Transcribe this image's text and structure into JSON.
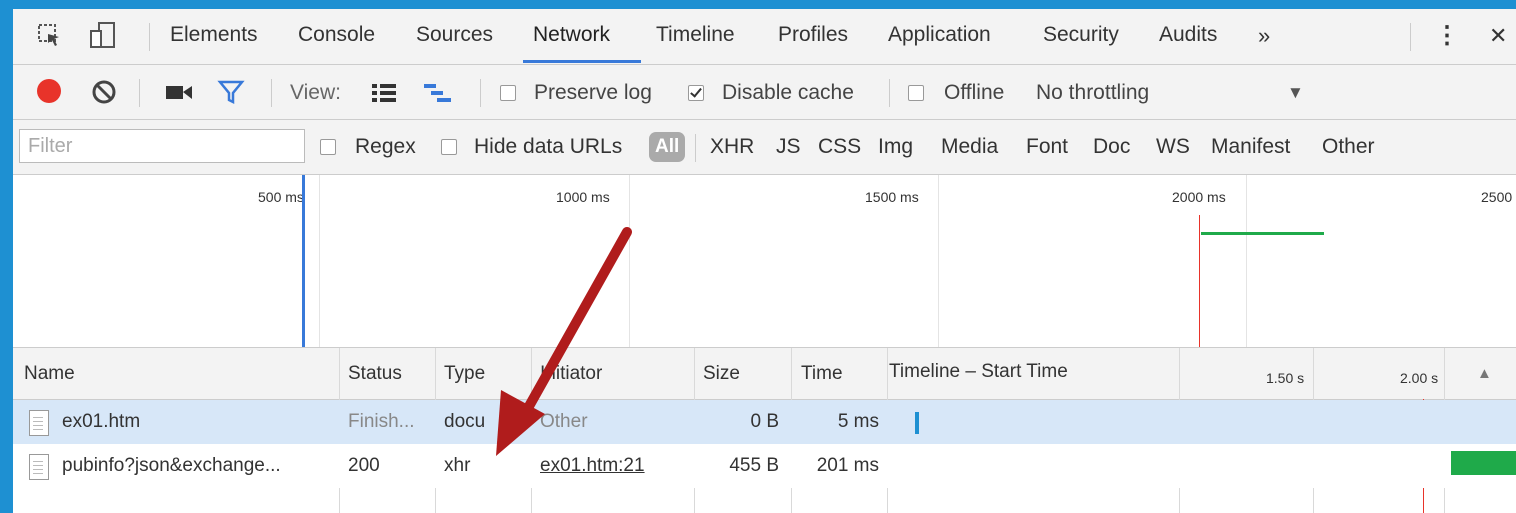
{
  "tabs": [
    {
      "label": "Elements"
    },
    {
      "label": "Console"
    },
    {
      "label": "Sources"
    },
    {
      "label": "Network",
      "active": true
    },
    {
      "label": "Timeline"
    },
    {
      "label": "Profiles"
    },
    {
      "label": "Application"
    },
    {
      "label": "Security"
    },
    {
      "label": "Audits"
    }
  ],
  "tabbar": {
    "overflow": "»",
    "menu": "⋮",
    "close": "✕"
  },
  "toolbar": {
    "view_label": "View:",
    "preserve_log": {
      "label": "Preserve log",
      "checked": false
    },
    "disable_cache": {
      "label": "Disable cache",
      "checked": true
    },
    "offline": {
      "label": "Offline",
      "checked": false
    },
    "throttling": "No throttling",
    "dropdown_arrow": "▼",
    "record_color": "#e8332a",
    "filter_color": "#3879d9"
  },
  "filterbar": {
    "placeholder": "Filter",
    "regex": {
      "label": "Regex",
      "checked": false
    },
    "hide_data_urls": {
      "label": "Hide data URLs",
      "checked": false
    },
    "all": "All",
    "types": [
      "XHR",
      "JS",
      "CSS",
      "Img",
      "Media",
      "Font",
      "Doc",
      "WS",
      "Manifest",
      "Other"
    ]
  },
  "overview": {
    "labels": [
      "500 ms",
      "1000 ms",
      "1500 ms",
      "2000 ms",
      "2500"
    ],
    "dom_content_loaded_color": "#3879d9",
    "load_color": "#e8332a",
    "bar_color": "#1faa4a"
  },
  "table": {
    "columns": {
      "name": "Name",
      "status": "Status",
      "type": "Type",
      "initiator": "Initiator",
      "size": "Size",
      "time": "Time",
      "timeline": "Timeline – Start Time",
      "tick1": "1.50 s",
      "tick2": "2.00 s",
      "sort": "▲"
    },
    "rows": [
      {
        "name": "ex01.htm",
        "status": "Finish...",
        "type": "docu",
        "initiator": "Other",
        "size": "0 B",
        "time": "5 ms"
      },
      {
        "name": "pubinfo?json&exchange...",
        "status": "200",
        "type": "xhr",
        "initiator": "ex01.htm:21",
        "size": "455 B",
        "time": "201 ms"
      }
    ]
  },
  "annotation": {
    "arrow_color": "#b01c1c"
  }
}
